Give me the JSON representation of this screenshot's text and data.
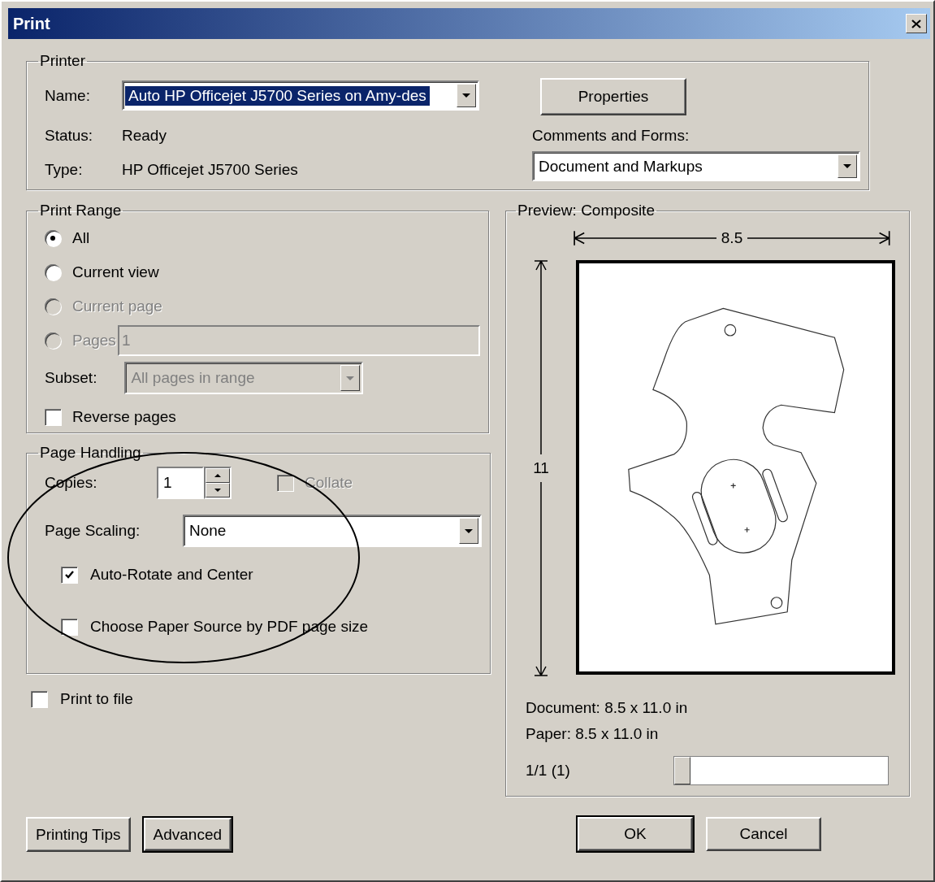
{
  "window": {
    "title": "Print"
  },
  "printer": {
    "title": "Printer",
    "name_label": "Name:",
    "name_value": "Auto HP Officejet J5700 Series on Amy-des",
    "status_label": "Status:",
    "status_value": "Ready",
    "type_label": "Type:",
    "type_value": "HP Officejet J5700 Series",
    "properties_button": "Properties",
    "comments_label": "Comments and Forms:",
    "comments_value": "Document and Markups"
  },
  "print_range": {
    "title": "Print Range",
    "options": [
      {
        "label": "All",
        "selected": true,
        "disabled": false
      },
      {
        "label": "Current view",
        "selected": false,
        "disabled": false
      },
      {
        "label": "Current page",
        "selected": false,
        "disabled": true
      },
      {
        "label": "Pages",
        "selected": false,
        "disabled": true,
        "field_value": "1"
      }
    ],
    "subset_label": "Subset:",
    "subset_value": "All pages in range",
    "subset_disabled": true,
    "reverse": {
      "label": "Reverse pages",
      "checked": false
    }
  },
  "page_handling": {
    "title": "Page Handling",
    "copies_label": "Copies:",
    "copies_value": "1",
    "collate": {
      "label": "Collate",
      "checked": false,
      "disabled": true
    },
    "scaling_label": "Page Scaling:",
    "scaling_value": "None",
    "options": [
      {
        "label": "Auto-Rotate and Center",
        "checked": true
      },
      {
        "label": "Choose Paper Source by PDF page size",
        "checked": false
      }
    ]
  },
  "print_to_file": {
    "label": "Print to file",
    "checked": false
  },
  "preview": {
    "title": "Preview: Composite",
    "width_label": "8.5",
    "height_label": "11",
    "document": "Document: 8.5 x 11.0 in",
    "paper": "Paper: 8.5 x 11.0 in",
    "page_label": "1/1 (1)",
    "page_slider": {
      "level": 0
    }
  },
  "left_buttons": [
    {
      "label": "Printing Tips",
      "default": false
    },
    {
      "label": "Advanced",
      "default": true
    }
  ],
  "right_buttons": [
    {
      "label": "OK",
      "default": true
    },
    {
      "label": "Cancel",
      "default": false
    }
  ],
  "annotations": [
    {
      "kind": "ellipse"
    }
  ]
}
